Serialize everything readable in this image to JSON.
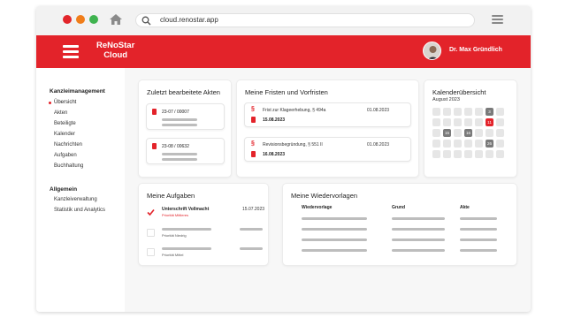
{
  "browser": {
    "url": "cloud.renostar.app",
    "colors": {
      "close": "#e2252b",
      "minimize": "#f07d1a",
      "maximize": "#3fb34f"
    }
  },
  "header": {
    "brand_line1": "ReNoStar",
    "brand_line2": "Cloud",
    "user_name": "Dr. Max Gründlich",
    "accent": "#e3232a"
  },
  "sidebar": {
    "section1_title": "Kanzleimanagement",
    "section1_items": [
      "Übersicht",
      "Akten",
      "Beteiligte",
      "Kalender",
      "Nachrichten",
      "Aufgaben",
      "Buchhaltung"
    ],
    "section2_title": "Allgemein",
    "section2_items": [
      "Kanzleiverwaltung",
      "Statistik und Analytics"
    ]
  },
  "akten": {
    "title": "Zuletzt bearbeitete Akten",
    "items": [
      {
        "number": "23-07 / 00007"
      },
      {
        "number": "23-08 / 00632"
      }
    ]
  },
  "fristen": {
    "title": "Meine Fristen und Vorfristen",
    "items": [
      {
        "label": "Frist zur Klageerhebung, § 494a",
        "date_small": "01.08.2023",
        "date_bold": "15.08.2023"
      },
      {
        "label": "Revisionsbegründung, § 551 II",
        "date_small": "01.08.2023",
        "date_bold": "16.08.2023"
      }
    ]
  },
  "kalender": {
    "title": "Kalenderübersicht",
    "month": "August 2023",
    "marked": {
      "dark1": "3",
      "red": "11",
      "dark2": "15",
      "dark3": "16",
      "dark4": "26"
    }
  },
  "aufgaben": {
    "title": "Meine Aufgaben",
    "items": [
      {
        "title": "Unterschrift Vollmacht",
        "priority": "Priorität Mittleres",
        "date": "15.07.2023",
        "done": true
      },
      {
        "priority": "Priorität Niedrig",
        "done": false
      },
      {
        "priority": "Priorität Mittel",
        "done": false
      }
    ]
  },
  "wiedervorlagen": {
    "title": "Meine Wiedervorlagen",
    "columns": [
      "Wiedervorlage",
      "Grund",
      "Akte"
    ]
  }
}
